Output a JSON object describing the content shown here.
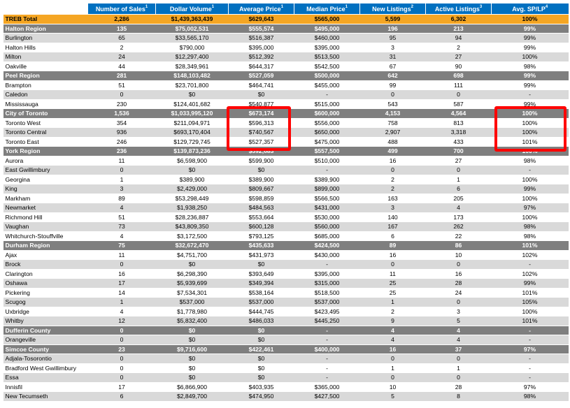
{
  "headers": [
    "",
    "Number of Sales",
    "Dollar Volume",
    "Average Price",
    "Median Price",
    "New Listings",
    "Active Listings",
    "Avg. SP/LP"
  ],
  "header_sup": [
    "",
    "1",
    "1",
    "1",
    "1",
    "2",
    "3",
    "4"
  ],
  "rows": [
    {
      "type": "total",
      "cells": [
        "TREB Total",
        "2,286",
        "$1,439,363,439",
        "$629,643",
        "$565,000",
        "5,599",
        "6,302",
        "100%"
      ]
    },
    {
      "type": "region",
      "cells": [
        "Halton Region",
        "135",
        "$75,002,531",
        "$555,574",
        "$495,000",
        "196",
        "213",
        "99%"
      ]
    },
    {
      "type": "alt",
      "cells": [
        "Burlington",
        "65",
        "$33,565,170",
        "$516,387",
        "$460,000",
        "95",
        "94",
        "99%"
      ]
    },
    {
      "type": "plain",
      "cells": [
        "Halton Hills",
        "2",
        "$790,000",
        "$395,000",
        "$395,000",
        "3",
        "2",
        "99%"
      ]
    },
    {
      "type": "alt",
      "cells": [
        "Milton",
        "24",
        "$12,297,400",
        "$512,392",
        "$513,500",
        "31",
        "27",
        "100%"
      ]
    },
    {
      "type": "plain",
      "cells": [
        "Oakville",
        "44",
        "$28,349,961",
        "$644,317",
        "$542,500",
        "67",
        "90",
        "98%"
      ]
    },
    {
      "type": "region",
      "cells": [
        "Peel Region",
        "281",
        "$148,103,482",
        "$527,059",
        "$500,000",
        "642",
        "698",
        "99%"
      ]
    },
    {
      "type": "plain",
      "cells": [
        "Brampton",
        "51",
        "$23,701,800",
        "$464,741",
        "$455,000",
        "99",
        "111",
        "99%"
      ]
    },
    {
      "type": "alt",
      "cells": [
        "Caledon",
        "0",
        "$0",
        "$0",
        "-",
        "0",
        "0",
        "-"
      ]
    },
    {
      "type": "plain",
      "cells": [
        "Mississauga",
        "230",
        "$124,401,682",
        "$540,877",
        "$515,000",
        "543",
        "587",
        "99%"
      ]
    },
    {
      "type": "region",
      "cells": [
        "City of Toronto",
        "1,536",
        "$1,033,995,120",
        "$673,174",
        "$600,000",
        "4,153",
        "4,564",
        "100%"
      ]
    },
    {
      "type": "plain",
      "cells": [
        "Toronto West",
        "354",
        "$211,094,971",
        "$596,313",
        "$556,000",
        "758",
        "813",
        "100%"
      ]
    },
    {
      "type": "alt",
      "cells": [
        "Toronto Central",
        "936",
        "$693,170,404",
        "$740,567",
        "$650,000",
        "2,907",
        "3,318",
        "100%"
      ]
    },
    {
      "type": "plain",
      "cells": [
        "Toronto East",
        "246",
        "$129,729,745",
        "$527,357",
        "$475,000",
        "488",
        "433",
        "101%"
      ]
    },
    {
      "type": "region",
      "cells": [
        "York Region",
        "236",
        "$139,873,236",
        "$592,683",
        "$557,500",
        "499",
        "700",
        "100%"
      ]
    },
    {
      "type": "plain",
      "cells": [
        "Aurora",
        "11",
        "$6,598,900",
        "$599,900",
        "$510,000",
        "16",
        "27",
        "98%"
      ]
    },
    {
      "type": "alt",
      "cells": [
        "East Gwillimbury",
        "0",
        "$0",
        "$0",
        "-",
        "0",
        "0",
        "-"
      ]
    },
    {
      "type": "plain",
      "cells": [
        "Georgina",
        "1",
        "$389,900",
        "$389,900",
        "$389,900",
        "2",
        "1",
        "100%"
      ]
    },
    {
      "type": "alt",
      "cells": [
        "King",
        "3",
        "$2,429,000",
        "$809,667",
        "$899,000",
        "2",
        "6",
        "99%"
      ]
    },
    {
      "type": "plain",
      "cells": [
        "Markham",
        "89",
        "$53,298,449",
        "$598,859",
        "$566,500",
        "163",
        "205",
        "100%"
      ]
    },
    {
      "type": "alt",
      "cells": [
        "Newmarket",
        "4",
        "$1,938,250",
        "$484,563",
        "$431,000",
        "3",
        "4",
        "97%"
      ]
    },
    {
      "type": "plain",
      "cells": [
        "Richmond Hill",
        "51",
        "$28,236,887",
        "$553,664",
        "$530,000",
        "140",
        "173",
        "100%"
      ]
    },
    {
      "type": "alt",
      "cells": [
        "Vaughan",
        "73",
        "$43,809,350",
        "$600,128",
        "$560,000",
        "167",
        "262",
        "98%"
      ]
    },
    {
      "type": "plain",
      "cells": [
        "Whitchurch-Stouffville",
        "4",
        "$3,172,500",
        "$793,125",
        "$685,000",
        "6",
        "22",
        "98%"
      ]
    },
    {
      "type": "region",
      "cells": [
        "Durham Region",
        "75",
        "$32,672,470",
        "$435,633",
        "$424,500",
        "89",
        "86",
        "101%"
      ]
    },
    {
      "type": "plain",
      "cells": [
        "Ajax",
        "11",
        "$4,751,700",
        "$431,973",
        "$430,000",
        "16",
        "10",
        "102%"
      ]
    },
    {
      "type": "alt",
      "cells": [
        "Brock",
        "0",
        "$0",
        "$0",
        "-",
        "0",
        "0",
        "-"
      ]
    },
    {
      "type": "plain",
      "cells": [
        "Clarington",
        "16",
        "$6,298,390",
        "$393,649",
        "$395,000",
        "11",
        "16",
        "102%"
      ]
    },
    {
      "type": "alt",
      "cells": [
        "Oshawa",
        "17",
        "$5,939,699",
        "$349,394",
        "$315,000",
        "25",
        "28",
        "99%"
      ]
    },
    {
      "type": "plain",
      "cells": [
        "Pickering",
        "14",
        "$7,534,301",
        "$538,164",
        "$518,500",
        "25",
        "24",
        "101%"
      ]
    },
    {
      "type": "alt",
      "cells": [
        "Scugog",
        "1",
        "$537,000",
        "$537,000",
        "$537,000",
        "1",
        "0",
        "105%"
      ]
    },
    {
      "type": "plain",
      "cells": [
        "Uxbridge",
        "4",
        "$1,778,980",
        "$444,745",
        "$423,495",
        "2",
        "3",
        "100%"
      ]
    },
    {
      "type": "alt",
      "cells": [
        "Whitby",
        "12",
        "$5,832,400",
        "$486,033",
        "$445,250",
        "9",
        "5",
        "101%"
      ]
    },
    {
      "type": "region",
      "cells": [
        "Dufferin County",
        "0",
        "$0",
        "$0",
        "-",
        "4",
        "4",
        "-"
      ]
    },
    {
      "type": "alt",
      "cells": [
        "Orangeville",
        "0",
        "$0",
        "$0",
        "-",
        "4",
        "4",
        "-"
      ]
    },
    {
      "type": "region",
      "cells": [
        "Simcoe County",
        "23",
        "$9,716,600",
        "$422,461",
        "$400,000",
        "16",
        "37",
        "97%"
      ]
    },
    {
      "type": "alt",
      "cells": [
        "Adjala-Tosorontio",
        "0",
        "$0",
        "$0",
        "-",
        "0",
        "0",
        "-"
      ]
    },
    {
      "type": "plain",
      "cells": [
        "Bradford West Gwillimbury",
        "0",
        "$0",
        "$0",
        "-",
        "1",
        "1",
        "-"
      ]
    },
    {
      "type": "alt",
      "cells": [
        "Essa",
        "0",
        "$0",
        "$0",
        "-",
        "0",
        "0",
        "-"
      ]
    },
    {
      "type": "plain",
      "cells": [
        "Innisfil",
        "17",
        "$6,866,900",
        "$403,935",
        "$365,000",
        "10",
        "28",
        "97%"
      ]
    },
    {
      "type": "alt",
      "cells": [
        "New Tecumseth",
        "6",
        "$2,849,700",
        "$474,950",
        "$427,500",
        "5",
        "8",
        "98%"
      ]
    }
  ],
  "highlight_color": "#ff0000"
}
